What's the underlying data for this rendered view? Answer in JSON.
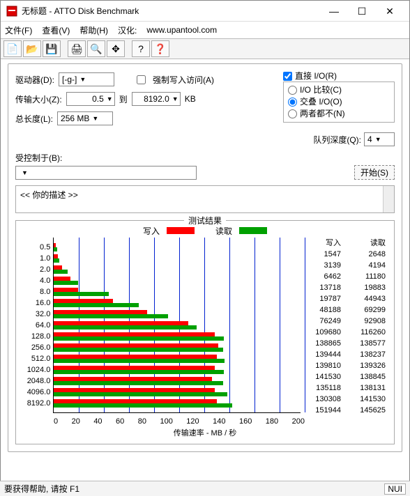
{
  "window": {
    "title": "无标题 - ATTO Disk Benchmark",
    "min": "—",
    "max": "☐",
    "close": "✕"
  },
  "menu": {
    "file": "文件(F)",
    "view": "查看(V)",
    "help": "帮助(H)",
    "localize_label": "汉化:",
    "localize_url": "www.upantool.com"
  },
  "toolbar": {
    "new": "📄",
    "open": "📂",
    "save": "💾",
    "print": "🖨",
    "preview": "🔍",
    "move": "✥",
    "help": "?",
    "whatsthis": "❓"
  },
  "form": {
    "drive_label": "驱动器(D):",
    "drive_value": "[-g-]",
    "force_write_label": "强制写入访问(A)",
    "direct_io_label": "直接 I/O(R)",
    "io_compare_label": "I/O 比较(C)",
    "overlap_io_label": "交叠 I/O(O)",
    "neither_label": "两者都不(N)",
    "xfer_label": "传输大小(Z):",
    "xfer_from": "0.5",
    "xfer_to_label": "到",
    "xfer_to": "8192.0",
    "xfer_unit": "KB",
    "total_len_label": "总长度(L):",
    "total_len_value": "256 MB",
    "queue_depth_label": "队列深度(Q):",
    "queue_depth_value": "4",
    "controlled_label": "受控制于(B):",
    "start_btn": "开始(S)",
    "desc_text": "<<   你的描述    >>"
  },
  "results": {
    "title": "测试结果",
    "write_label": "写入",
    "read_label": "读取",
    "xaxis_label": "传输速率 - MB / 秒",
    "x_ticks": [
      "0",
      "20",
      "40",
      "60",
      "80",
      "100",
      "120",
      "140",
      "160",
      "180",
      "200"
    ],
    "x_max": 200
  },
  "chart_data": {
    "type": "bar",
    "orientation": "horizontal",
    "categories": [
      "0.5",
      "1.0",
      "2.0",
      "4.0",
      "8.0",
      "16.0",
      "32.0",
      "64.0",
      "128.0",
      "256.0",
      "512.0",
      "1024.0",
      "2048.0",
      "4096.0",
      "8192.0"
    ],
    "xlabel": "传输速率 - MB / 秒",
    "ylabel": "",
    "xlim": [
      0,
      200
    ],
    "series": [
      {
        "name": "写入",
        "color": "#ff0000",
        "values_mb_s": [
          1.5,
          3.1,
          6.3,
          13.4,
          19.3,
          47.1,
          74.5,
          107.1,
          128,
          131,
          130,
          128,
          126,
          128,
          130
        ],
        "kb_values": [
          1547,
          3139,
          6462,
          13718,
          19787,
          48188,
          76249,
          109680,
          138865,
          139444,
          139810,
          141530,
          135118,
          130308,
          151944
        ]
      },
      {
        "name": "读取",
        "color": "#00a000",
        "values_mb_s": [
          2.6,
          4.1,
          10.9,
          19.4,
          43.9,
          67.7,
          90.7,
          113.5,
          135.3,
          135.0,
          136.1,
          135.6,
          134.9,
          138.2,
          142.2
        ],
        "kb_values": [
          2648,
          4194,
          11180,
          19883,
          44943,
          69299,
          92908,
          116260,
          138577,
          138237,
          139326,
          138845,
          138131,
          141530,
          145625
        ]
      }
    ]
  },
  "status": {
    "help_text": "要获得帮助, 请按 F1",
    "right": "NUI"
  }
}
